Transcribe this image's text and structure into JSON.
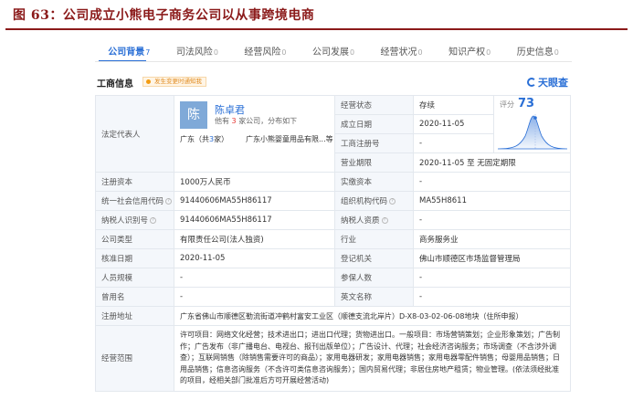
{
  "figure": {
    "title": "图 63：公司成立小熊电子商务公司以从事跨境电商"
  },
  "tabs": [
    {
      "label": "公司背景",
      "count": "7",
      "active": true
    },
    {
      "label": "司法风险",
      "count": "0",
      "active": false
    },
    {
      "label": "经营风险",
      "count": "0",
      "active": false
    },
    {
      "label": "公司发展",
      "count": "0",
      "active": false
    },
    {
      "label": "经营状况",
      "count": "0",
      "active": false
    },
    {
      "label": "知识产权",
      "count": "0",
      "active": false
    },
    {
      "label": "历史信息",
      "count": "0",
      "active": false
    }
  ],
  "section": {
    "title": "工商信息",
    "badge": "发生变更时通知我",
    "brand": "天眼查"
  },
  "rep": {
    "label": "法定代表人",
    "avatar_char": "陈",
    "name": "陈卓君",
    "sub_prefix": "他有",
    "sub_count": "3",
    "sub_suffix": "家公司，分布如下",
    "region": "广东（共",
    "region_count": "3",
    "region_suffix": "家）",
    "company": "广东小熊婴童用品有限...等"
  },
  "score": {
    "label": "评分",
    "value": "73"
  },
  "right_top": [
    {
      "label": "经营状态",
      "value": "存续"
    },
    {
      "label": "成立日期",
      "value": "2020-11-05"
    },
    {
      "label": "工商注册号",
      "value": "-"
    },
    {
      "label": "营业期限",
      "value": "2020-11-05 至 无固定期限"
    }
  ],
  "rows": [
    {
      "l1": "注册资本",
      "v1": "1000万人民币",
      "l2": "实缴资本",
      "v2": "-"
    },
    {
      "l1": "统一社会信用代码",
      "v1": "91440606MA55H86117",
      "l2": "组织机构代码",
      "v2": "MA55H8611"
    },
    {
      "l1": "纳税人识别号",
      "v1": "91440606MA55H86117",
      "l2": "纳税人资质",
      "v2": "-"
    },
    {
      "l1": "公司类型",
      "v1": "有限责任公司(法人独资)",
      "l2": "行业",
      "v2": "商务服务业"
    },
    {
      "l1": "核准日期",
      "v1": "2020-11-05",
      "l2": "登记机关",
      "v2": "佛山市顺德区市场监督管理局"
    },
    {
      "l1": "人员规模",
      "v1": "-",
      "l2": "参保人数",
      "v2": "-"
    },
    {
      "l1": "曾用名",
      "v1": "-",
      "l2": "英文名称",
      "v2": "-"
    }
  ],
  "address": {
    "label": "注册地址",
    "value": "广东省佛山市顺德区勒流街道冲鹤村富安工业区（顺德支流北岸片）D-X8-03-02-06-08地块（住所申报）"
  },
  "scope": {
    "label": "经营范围",
    "value": "许可项目：网络文化经营；技术进出口；进出口代理；货物进出口。一般项目：市场营销策划；企业形象策划；广告制作；广告发布（非广播电台、电视台、报刊出版单位）；广告设计、代理；社会经济咨询服务；市场调查（不含涉外调查）；互联网销售（除销售需要许可的商品）；家用电器研发；家用电器销售；家用电器零配件销售；母婴用品销售；日用品销售；信息咨询服务（不含许可类信息咨询服务）；国内贸易代理；非居住房地产租赁；物业管理。(依法须经批准的项目，经相关部门批准后方可开展经营活动)"
  },
  "colors": {
    "accent": "#2a6fd6",
    "title_red": "#8b1a1a",
    "label_bg": "#f4f7fb"
  }
}
